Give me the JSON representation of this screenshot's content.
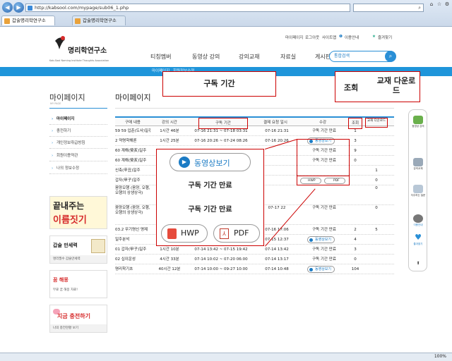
{
  "browser": {
    "url": "http://kabsool.com/mypage/sub06_1.php",
    "tabs": [
      "갑술명리학연구소",
      "갑술명리학연구소"
    ],
    "back_icon": "back-arrow-icon",
    "forward_icon": "forward-arrow-icon",
    "zoom": "100%"
  },
  "site": {
    "logo_text": "명리학연구소",
    "logo_sub": "Kab-Sool Naming Institute Thoughts Association",
    "top_links": [
      "마이페이지",
      "로그아웃",
      "사이트맵",
      "이용안내",
      "즐겨찾기"
    ],
    "nav": [
      "티칭멤버",
      "동영상 강의",
      "강의교재",
      "자료실",
      "게시판"
    ],
    "search_placeholder": "통합검색",
    "subnav": [
      "마이페이지",
      "회원정보수정"
    ]
  },
  "sidebar": {
    "title": "마이페이지",
    "subtitle": "MY PAGE",
    "items": [
      "마이페이지",
      "충전하기",
      "개인정보취급방침",
      "회원이용약관",
      "나의 정보수정"
    ]
  },
  "banners": {
    "name_line1": "끝내주는",
    "name_line2": "이름짓기",
    "manse_title": "갑술 만세력",
    "manse_sub": "명리필수 갑술만세력",
    "dream_title": "꿈 해몽",
    "dream_sub": "무료 꿈 해몽 자료!",
    "charge_title": "지금 충전하기",
    "charge_sub": "나의 충전현황 보기"
  },
  "main": {
    "title": "마이페이지",
    "headers": [
      "구매 내용",
      "강의 시간",
      "구독 기간",
      "결제 요청 일시",
      "수강",
      "조회",
      "교재 다운로드"
    ],
    "rows": [
      {
        "name": "59 59 입춘(도사)일주",
        "time": "1시간 46분",
        "period": "07-16 21:31 ~ 07-18 03:31",
        "paid": "07-16 21:31",
        "status": "구독 기간 만료",
        "views": "1",
        "down": ""
      },
      {
        "name": "2 약명학해론",
        "time": "1시간 25분",
        "period": "07-16 20:26 ~ 07-24 08:26",
        "paid": "07-16 20:26",
        "status": "동영상보기",
        "views": "3",
        "down": ""
      },
      {
        "name": "60 계해(癸亥)일주",
        "time": "",
        "period": "",
        "paid": "",
        "status": "구독 기간 만료",
        "views": "9",
        "down": ""
      },
      {
        "name": "60 계해(癸亥)일주",
        "time": "",
        "period": "",
        "paid": "",
        "status": "구독 기간 만료",
        "views": "0",
        "down": ""
      },
      {
        "name": "신축(辛丑)일주",
        "time": "",
        "period": "",
        "paid": "",
        "status": "",
        "views": "",
        "down": "1"
      },
      {
        "name": "갑자(甲子)일주",
        "time": "",
        "period": "",
        "paid": "",
        "status": "구독 기간 만료",
        "views": "",
        "down": "0"
      },
      {
        "name": "음양오행 (음양, 오행, 오행의 상생상극)",
        "time": "",
        "period": "",
        "paid": "",
        "status": "",
        "views": "",
        "down": "0"
      },
      {
        "name": "음양오행 (음양, 오행, 오행의 상생상극)",
        "time": "",
        "period": "",
        "paid": "07-17 22",
        "status": "구독 기간 만료",
        "views": "",
        "down": "0"
      },
      {
        "name": "03.2 무기명신 명제",
        "time": "",
        "period": "07-16 17:06",
        "paid": "07-16 17:06",
        "status": "구독 기간 만료",
        "views": "2",
        "down": "5"
      },
      {
        "name": "일주분석",
        "time": "56시간 24분",
        "period": "07-15 12:37 ~ 09-13 12:37",
        "paid": "07-15 12:37",
        "status": "동영상보기",
        "views": "4",
        "down": ""
      },
      {
        "name": "01 갑자(甲子)일주",
        "time": "1시간 10분",
        "period": "07-14 13:42 ~ 07-15 19:42",
        "paid": "07-14 13:42",
        "status": "구독 기간 만료",
        "views": "3",
        "down": ""
      },
      {
        "name": "02 십이운성",
        "time": "4시간 33분",
        "period": "07-14 10:02 ~ 07-20 06:00",
        "paid": "07-14 13:17",
        "status": "구독 기간 만료",
        "views": "0",
        "down": ""
      },
      {
        "name": "명리학기초",
        "time": "40시간 12분",
        "period": "07-14 10:00 ~ 09-27 10:00",
        "paid": "07-14 10:48",
        "status": "동영상보기",
        "views": "104",
        "down": ""
      }
    ]
  },
  "callouts": {
    "period_label": "구독 기간",
    "views_label": "조회",
    "download_label": "교재 다운로드",
    "video_button": "동영상보기",
    "expired1": "구독 기간 만료",
    "expired2": "구독 기간 만료",
    "hwp_button": "HWP",
    "pdf_button": "PDF",
    "small_hwp": "HWP",
    "small_pdf": "PDF"
  },
  "quickmenu": [
    "동영상 강의",
    "강의교재",
    "자주하는 질문",
    "이용안내",
    "즐겨찾기"
  ]
}
